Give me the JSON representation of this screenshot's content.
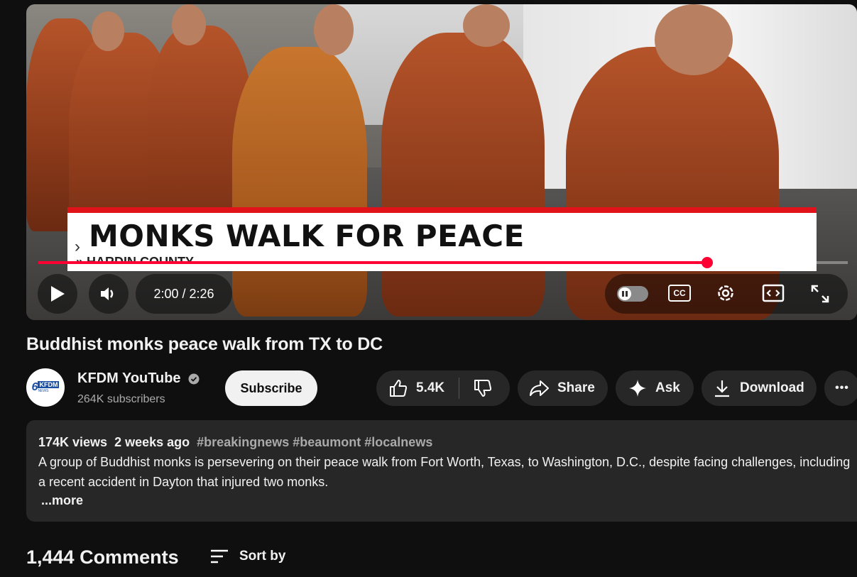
{
  "player": {
    "lower_third": {
      "chevron": "›",
      "headline": "MONKS WALK FOR PEACE",
      "subline": "» HARDIN COUNTY"
    },
    "time_display": "2:00 / 2:26",
    "progress_fraction": 0.826,
    "accent_color": "#ff0033",
    "controls": {
      "play": "play-icon",
      "volume": "volume-icon",
      "autoplay": "autoplay-toggle",
      "captions_label": "CC",
      "settings": "gear-icon",
      "miniplayer": "miniplayer-icon",
      "fullscreen": "fullscreen-icon"
    }
  },
  "video": {
    "title": "Buddhist monks peace walk from TX to DC"
  },
  "channel": {
    "name": "KFDM YouTube",
    "subscribers": "264K subscribers",
    "logo_text": "KFDM",
    "logo_sub": "NEWS",
    "logo_num": "6",
    "subscribe_label": "Subscribe"
  },
  "actions": {
    "likes": "5.4K",
    "share": "Share",
    "ask": "Ask",
    "download": "Download",
    "more": "•••"
  },
  "description": {
    "views": "174K views",
    "date": "2 weeks ago",
    "tags": [
      "#breakingnews",
      "#beaumont",
      "#localnews"
    ],
    "text": "A group of Buddhist monks is persevering on their peace walk from Fort Worth, Texas, to Washington, D.C., despite facing challenges, including a recent accident in Dayton that injured two monks.",
    "more_label": "...more"
  },
  "comments": {
    "count_label": "1,444 Comments",
    "sort_label": "Sort by"
  }
}
